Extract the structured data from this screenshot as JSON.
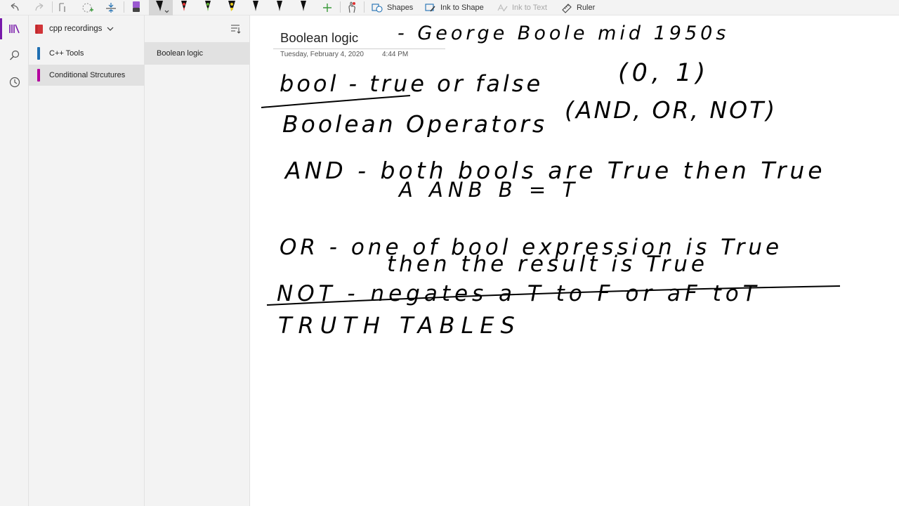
{
  "toolbar": {
    "shapes_label": "Shapes",
    "ink_to_shape_label": "Ink to Shape",
    "ink_to_text_label": "Ink to Text",
    "ruler_label": "Ruler",
    "pen_colors": [
      "#9b59d0",
      "#111111",
      "#e03030",
      "#5bb031",
      "#e8c81a",
      "#222222",
      "#222222",
      "#222222"
    ]
  },
  "notebook": {
    "name": "cpp recordings",
    "color": "#d13438"
  },
  "sections": [
    {
      "label": "C++ Tools",
      "color": "#1f6fb2"
    },
    {
      "label": "Conditional Strcutures",
      "color": "#b4009e"
    }
  ],
  "pages": [
    {
      "label": "Boolean logic"
    }
  ],
  "page": {
    "title": "Boolean logic",
    "date": "Tuesday, February 4, 2020",
    "time": "4:44 PM"
  },
  "ink_lines": [
    "- George Boole mid 1950s",
    "bool - true or false",
    "(0, 1)",
    "Boolean Operators",
    "(AND, OR, NOT)",
    "AND - both bools are True then True",
    "A ANB B = T",
    "OR - one of bool expression is True",
    "then the result is True",
    "NOT - negates a T to F or aF toT",
    "TRUTH TABLES"
  ]
}
